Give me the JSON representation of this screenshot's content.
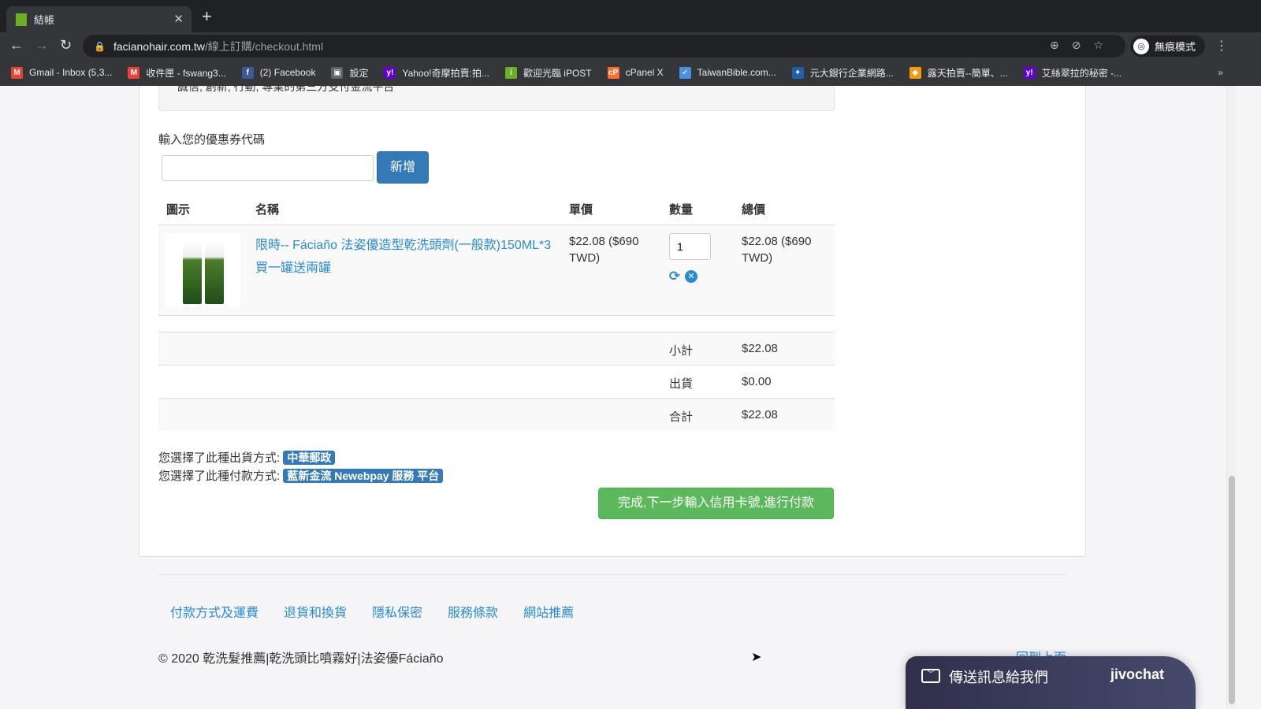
{
  "browser": {
    "tab_title": "結帳",
    "url_host": "facianohair.com.tw",
    "url_path": "/線上訂購/checkout.html",
    "profile": "無痕模式",
    "bookmarks": [
      {
        "label": "Gmail - Inbox (5,3...",
        "color": "#ea4335",
        "icon": "M"
      },
      {
        "label": "收件匣 - fswang3...",
        "color": "#ea4335",
        "icon": "M"
      },
      {
        "label": "(2) Facebook",
        "color": "#3b5998",
        "icon": "f"
      },
      {
        "label": "設定",
        "color": "#5f6368",
        "icon": "▣"
      },
      {
        "label": "Yahoo!奇摩拍賣:拍...",
        "color": "#6001d2",
        "icon": "y!"
      },
      {
        "label": "歡迎光臨 iPOST",
        "color": "#6ab023",
        "icon": "i"
      },
      {
        "label": "cPanel X",
        "color": "#ff6c2c",
        "icon": "cP"
      },
      {
        "label": "TaiwanBible.com...",
        "color": "#4a90e2",
        "icon": "✓"
      },
      {
        "label": "元大銀行企業網路...",
        "color": "#1f5fa8",
        "icon": "✦"
      },
      {
        "label": "露天拍賣--簡單、...",
        "color": "#f39c12",
        "icon": "◆"
      },
      {
        "label": "艾絲翠拉的秘密 -...",
        "color": "#6001d2",
        "icon": "y!"
      }
    ]
  },
  "payment_note": "誠信, 創新, 行動, 專業的第三方支付金流平台",
  "coupon": {
    "label": "輸入您的優惠券代碼",
    "value": "",
    "add_button": "新增"
  },
  "table": {
    "headers": [
      "圖示",
      "名稱",
      "單價",
      "數量",
      "總價"
    ],
    "item": {
      "name": "限時-- Fáciaño 法姿優造型乾洗頭劑(一般款)150ML*3 買一罐送兩罐",
      "unit_price": "$22.08 ($690 TWD)",
      "quantity": "1",
      "total": "$22.08 ($690 TWD)"
    }
  },
  "summary": [
    {
      "label": "小計",
      "value": "$22.08"
    },
    {
      "label": "出貨",
      "value": "$0.00"
    },
    {
      "label": "合計",
      "value": "$22.08"
    }
  ],
  "shipping": {
    "label": "您選擇了此種出貨方式:",
    "value": "中華郵政"
  },
  "payment": {
    "label": "您選擇了此種付款方式:",
    "value": "藍新金流 Newebpay 服務 平台"
  },
  "checkout_button": "完成,下一步輸入信用卡號,進行付款",
  "footer": {
    "links": [
      "付款方式及運費",
      "退貨和換貨",
      "隱私保密",
      "服務條款",
      "網站推薦"
    ],
    "copyright": "© 2020 乾洗髮推薦|乾洗頭比噴霧好|法姿優Fáciaño",
    "back_to_top": "回到上面"
  },
  "chat": {
    "label": "傳送訊息給我們",
    "brand": "jivochat"
  }
}
